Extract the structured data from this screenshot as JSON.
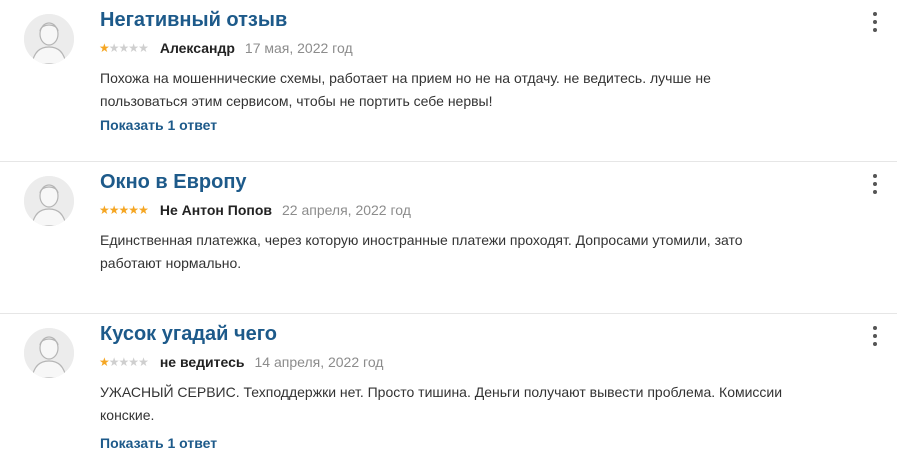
{
  "reviews": [
    {
      "title": "Негативный отзыв",
      "rating": 1,
      "author": "Александр",
      "date": "17 мая, 2022 год",
      "text": "Похожа на мошеннические схемы, работает на прием но не на отдачу. не ведитесь. лучше не пользоваться этим сервисом, чтобы не портить себе нервы!",
      "reply_link": "Показать 1 ответ"
    },
    {
      "title": "Окно в Европу",
      "rating": 5,
      "author": "Не Антон Попов",
      "date": "22 апреля, 2022 год",
      "text": "Единственная платежка, через которую иностранные платежи проходят. Допросами утомили, зато работают нормально."
    },
    {
      "title": "Кусок угадай чего",
      "rating": 1,
      "author": "не ведитесь",
      "date": "14 апреля, 2022 год",
      "text": "УЖАСНЫЙ СЕРВИС. Техподдержки нет. Просто тишина. Деньги получают вывести проблема. Комиссии конские.",
      "reply_link": "Показать 1 ответ"
    }
  ],
  "colors": {
    "title": "#1d5a8a",
    "star_on": "#f5a623",
    "star_off": "#cfcfcf",
    "date": "#8c8c8c"
  },
  "icons": {
    "avatar": "user-silhouette-icon",
    "menu": "kebab-menu-icon",
    "star": "star-icon"
  }
}
